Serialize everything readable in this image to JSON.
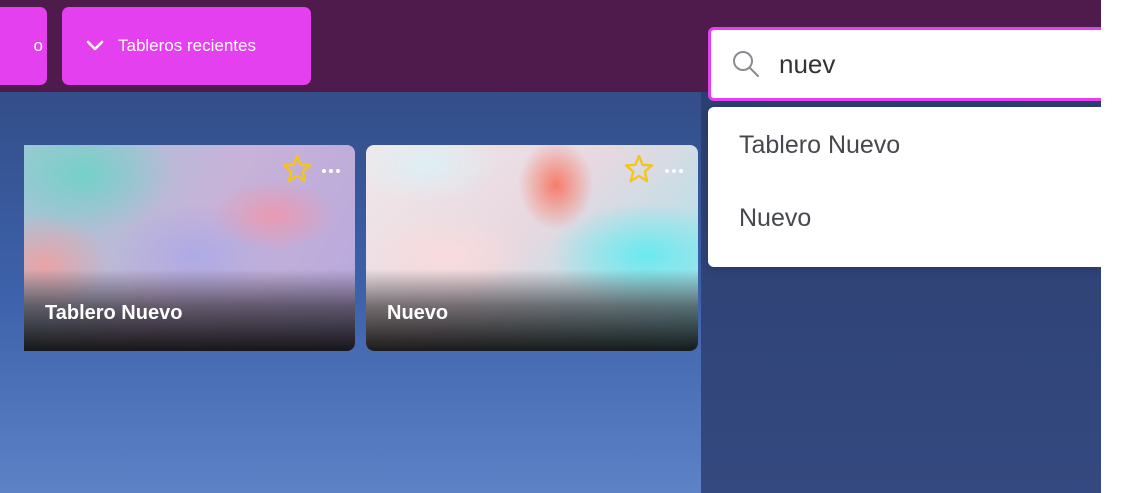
{
  "header": {
    "partial_button_label": "o",
    "recent_boards_label": "Tableros recientes",
    "icon": "chevron-down-icon"
  },
  "search": {
    "value": "nuev",
    "icon": "search-icon",
    "results": [
      {
        "label": "Tablero Nuevo"
      },
      {
        "label": "Nuevo"
      }
    ]
  },
  "boards": [
    {
      "title": "Tablero Nuevo",
      "starred": true
    },
    {
      "title": "Nuevo",
      "starred": true
    }
  ],
  "colors": {
    "header_bg": "#4f1a4c",
    "accent": "#e540ef",
    "star": "#f5c518"
  }
}
